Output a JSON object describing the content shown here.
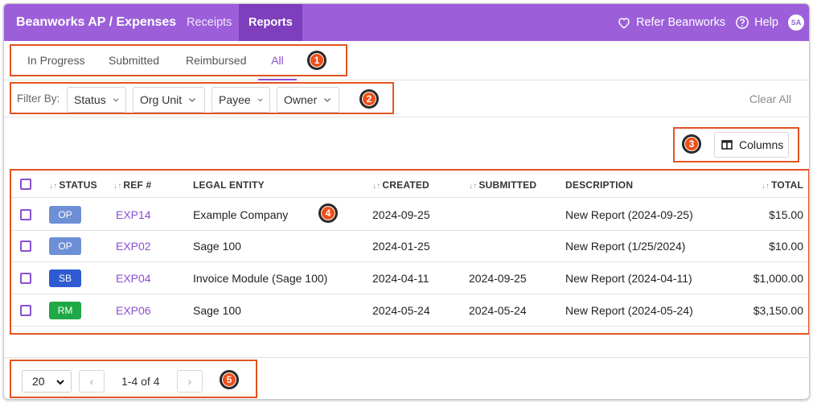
{
  "topbar": {
    "brand": "Beanworks AP / Expenses",
    "nav": [
      "Receipts",
      "Reports"
    ],
    "refer": "Refer Beanworks",
    "help": "Help",
    "avatar": "SA",
    "color": "#9c5fd9",
    "active_color": "#7d3fbb"
  },
  "tabs": [
    "In Progress",
    "Submitted",
    "Reimbursed",
    "All"
  ],
  "active_tab": "All",
  "filters": {
    "label": "Filter By:",
    "items": [
      "Status",
      "Org Unit",
      "Payee",
      "Owner"
    ],
    "clear": "Clear All"
  },
  "columns_button": "Columns",
  "table": {
    "headers": [
      "STATUS",
      "REF #",
      "LEGAL ENTITY",
      "CREATED",
      "SUBMITTED",
      "DESCRIPTION",
      "TOTAL"
    ],
    "rows": [
      {
        "status": "OP",
        "status_color": "#6d8fd6",
        "ref": "EXP14",
        "entity": "Example Company",
        "created": "2024-09-25",
        "submitted": "",
        "description": "New Report (2024-09-25)",
        "total": "$15.00"
      },
      {
        "status": "OP",
        "status_color": "#6d8fd6",
        "ref": "EXP02",
        "entity": "Sage 100",
        "created": "2024-01-25",
        "submitted": "",
        "description": "New Report (1/25/2024)",
        "total": "$10.00"
      },
      {
        "status": "SB",
        "status_color": "#2e5bd1",
        "ref": "EXP04",
        "entity": "Invoice Module (Sage 100)",
        "created": "2024-04-11",
        "submitted": "2024-09-25",
        "description": "New Report (2024-04-11)",
        "total": "$1,000.00"
      },
      {
        "status": "RM",
        "status_color": "#1fa845",
        "ref": "EXP06",
        "entity": "Sage 100",
        "created": "2024-05-24",
        "submitted": "2024-05-24",
        "description": "New Report (2024-05-24)",
        "total": "$3,150.00"
      }
    ]
  },
  "pager": {
    "page_size": "20",
    "prev": "‹",
    "next": "›",
    "count": "1-4 of 4"
  },
  "annotations": [
    "1",
    "2",
    "3",
    "4",
    "5"
  ],
  "annotation_color": "#e35322"
}
